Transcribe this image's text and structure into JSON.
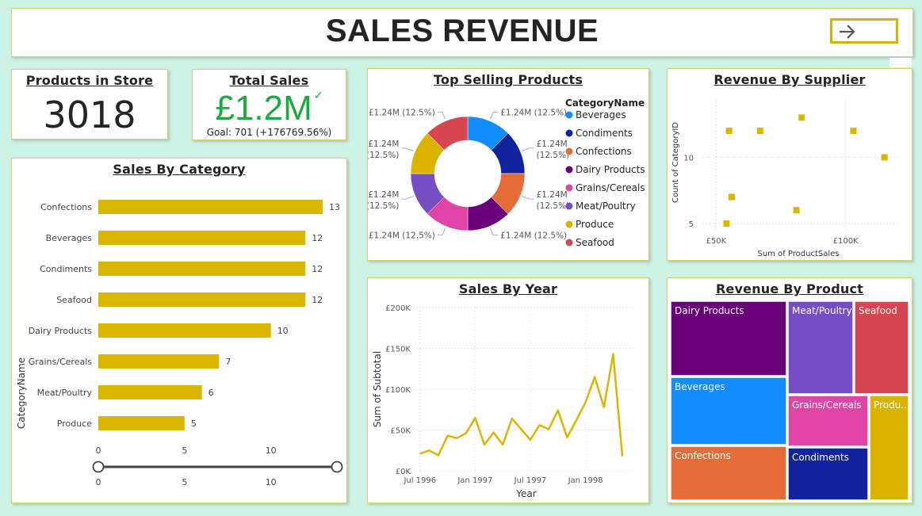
{
  "header": {
    "title": "SALES REVENUE",
    "nav_icon": "arrow-right-icon"
  },
  "kpis": {
    "products": {
      "title": "Products in Store",
      "value": "3018"
    },
    "sales": {
      "title": "Total Sales",
      "value": "£1.2M",
      "status_icon": "check-icon",
      "goal": "Goal: 701 (+176769.56%)"
    }
  },
  "colors": {
    "accent": "#DAB600",
    "good": "#1AAB40",
    "categories": {
      "Beverages": "#118DFF",
      "Condiments": "#12239E",
      "Confections": "#E66C37",
      "Dairy Products": "#6B007B",
      "Grains/Cereals": "#E044A7",
      "Meat/Poultry": "#744EC2",
      "Produce": "#D9B300",
      "Seafood": "#D64550"
    }
  },
  "chart_data": [
    {
      "id": "sales-by-category",
      "type": "bar",
      "orientation": "horizontal",
      "title": "Sales By Category",
      "ylabel": "CategoryName",
      "categories": [
        "Confections",
        "Beverages",
        "Condiments",
        "Seafood",
        "Dairy Products",
        "Grains/Cereals",
        "Meat/Poultry",
        "Produce"
      ],
      "values": [
        13,
        12,
        12,
        12,
        10,
        7,
        6,
        5
      ],
      "xticks": [
        "0",
        "5",
        "10"
      ],
      "xlim": [
        0,
        13
      ],
      "slider": {
        "range": [
          0,
          13
        ],
        "ticks": [
          "0",
          "5",
          "10"
        ]
      },
      "color": "#DAB600"
    },
    {
      "id": "top-selling-products",
      "type": "pie",
      "variant": "donut",
      "title": "Top Selling Products",
      "legend_title": "CategoryName",
      "legend_position": "right",
      "categories": [
        "Beverages",
        "Condiments",
        "Confections",
        "Dairy Products",
        "Grains/Cereals",
        "Meat/Poultry",
        "Produce",
        "Seafood"
      ],
      "values": [
        1.24,
        1.24,
        1.24,
        1.24,
        1.24,
        1.24,
        1.24,
        1.24
      ],
      "value_unit": "£M",
      "data_labels": [
        "£1.24M (12.5%)",
        "£1.24M (12.5%)",
        "£1.24M (12.5%)",
        "£1.24M (12.5%)",
        "£1.24M (12.5%)",
        "£1.24M (12.5%)",
        "£1.24M (12.5%)",
        "£1.24M (12.5%)"
      ]
    },
    {
      "id": "revenue-by-supplier",
      "type": "scatter",
      "title": "Revenue By Supplier",
      "xlabel": "Sum of ProductSales",
      "ylabel": "Count of CategoryID",
      "xticks": [
        "£50K",
        "£100K"
      ],
      "yticks": [
        "5",
        "10"
      ],
      "xlim": [
        45000,
        120000
      ],
      "ylim": [
        3.5,
        15
      ],
      "grid": true,
      "points": [
        {
          "x": 55000,
          "y": 12
        },
        {
          "x": 67000,
          "y": 12
        },
        {
          "x": 83000,
          "y": 13
        },
        {
          "x": 103000,
          "y": 12
        },
        {
          "x": 115000,
          "y": 10
        },
        {
          "x": 56000,
          "y": 7
        },
        {
          "x": 54000,
          "y": 5
        },
        {
          "x": 81000,
          "y": 6
        }
      ],
      "color": "#DAB600"
    },
    {
      "id": "sales-by-year",
      "type": "line",
      "title": "Sales By Year",
      "xlabel": "Year",
      "ylabel": "Sum of Subtotal",
      "xticks": [
        "Jul 1996",
        "Jan 1997",
        "Jul 1997",
        "Jan 1998"
      ],
      "yticks": [
        "£0K",
        "£50K",
        "£100K",
        "£150K",
        "£200K"
      ],
      "ylim": [
        0,
        200000
      ],
      "grid": true,
      "x": [
        "1996-07",
        "1996-08",
        "1996-09",
        "1996-10",
        "1996-11",
        "1996-12",
        "1997-01",
        "1997-02",
        "1997-03",
        "1997-04",
        "1997-05",
        "1997-06",
        "1997-07",
        "1997-08",
        "1997-09",
        "1997-10",
        "1997-11",
        "1997-12",
        "1998-01",
        "1998-02",
        "1998-03",
        "1998-04",
        "1998-05"
      ],
      "values": [
        21000,
        25000,
        19000,
        43000,
        40000,
        46000,
        65000,
        32000,
        47000,
        32000,
        64000,
        51000,
        38000,
        56000,
        51000,
        74000,
        41000,
        62000,
        84000,
        115000,
        78000,
        143000,
        18000
      ],
      "color": "#DAB600"
    },
    {
      "id": "revenue-by-product",
      "type": "treemap",
      "title": "Revenue By Product",
      "categories": [
        "Dairy Products",
        "Beverages",
        "Confections",
        "Meat/Poultry",
        "Seafood",
        "Grains/Cereals",
        "Condiments",
        "Produce"
      ],
      "labels": [
        "Dairy Products",
        "Beverages",
        "Confections",
        "Meat/Poultry",
        "Seafood",
        "Grains/Cereals",
        "Condiments",
        "Produ..."
      ]
    }
  ]
}
